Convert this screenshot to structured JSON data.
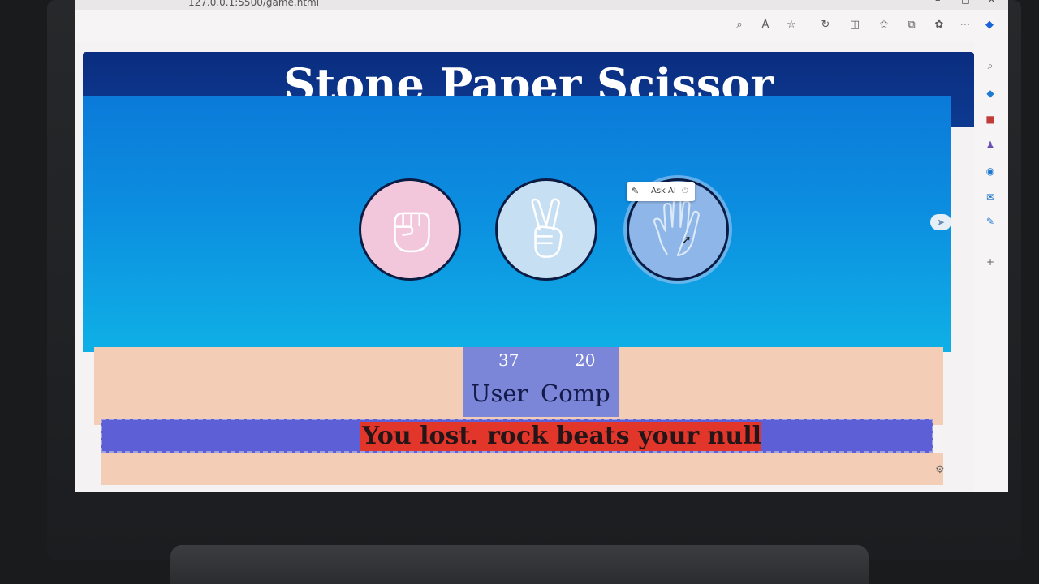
{
  "browser": {
    "url": "127.0.0.1:5500/game.html",
    "toolbar_icons": [
      "zoom-icon",
      "read-aloud-icon",
      "favorite-star-icon",
      "refresh-icon",
      "split-screen-icon",
      "favorites-icon",
      "collections-icon",
      "extensions-icon",
      "more-icon",
      "copilot-icon"
    ],
    "window_buttons": [
      "–",
      "◻",
      "✕"
    ]
  },
  "game": {
    "title": "Stone Paper Scissor",
    "choices": [
      "rock",
      "scissor",
      "paper"
    ],
    "ask_ai_label": "Ask AI",
    "scores": {
      "user_score": "37",
      "comp_score": "20",
      "user_label": "User",
      "comp_label": "Comp"
    },
    "message": "You lost. rock beats your null",
    "colors": {
      "header": "#0a2d80",
      "game_bg": "#0c8ee0",
      "score_box": "#7b86d8",
      "message_bg": "#e2362b",
      "message_strip": "#5d5fd6",
      "strip_bg": "#f4cdb6"
    }
  }
}
